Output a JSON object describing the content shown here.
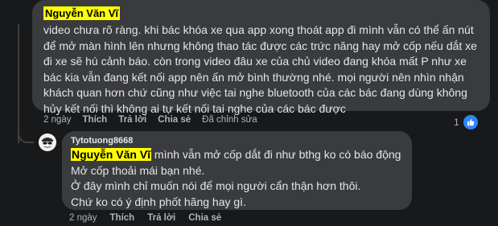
{
  "comment": {
    "author": "Nguyễn Văn Vĩ",
    "text": "video chưa rõ ràng. khi bác khóa xe qua app xong thoát app đi mình vẫn có thể ấn nút để mở màn hình lên nhưng không thao tác được các trức năng hay mở cốp nếu dắt xe đi xe sẽ hú cảnh báo. còn trong video đâu xe của chủ video đang khóa mất P như xe bác kia vẫn đang kết nối app nên ấn mở bình thường nhé. mọi người nên nhìn nhận khách quan hơn chứ cũng như việc tai nghe bluetooth của các bác đang dùng không hủy kết nối thì không ai tự kết nối tai nghe của các bác được",
    "actions": {
      "time": "2 ngày",
      "like": "Thích",
      "reply": "Trả lời",
      "share": "Chia sẻ",
      "edited": "Đã chỉnh sửa"
    },
    "reaction_count": "1",
    "reaction_icon": "like-icon"
  },
  "reply": {
    "author": "Tytotuong8668",
    "mention": "Nguyễn Văn Vĩ",
    "line1": " mình vẫn mở cốp dắt đi như bthg ko có báo động",
    "line2": "Mở cốp thoải mái bạn nhé.",
    "line3": "Ở đây mình chỉ muốn nói để mọi người cẩn thận hơn thôi.",
    "line4": "Chứ ko có ý định phốt hãng hay gì.",
    "actions": {
      "time": "2 ngày",
      "like": "Thích",
      "reply": "Trả lời",
      "share": "Chia sẻ"
    }
  },
  "colors": {
    "background": "#18191a",
    "bubble": "#3a3b3c",
    "highlight": "#ffff00",
    "like_blue": "#2d86ff"
  }
}
